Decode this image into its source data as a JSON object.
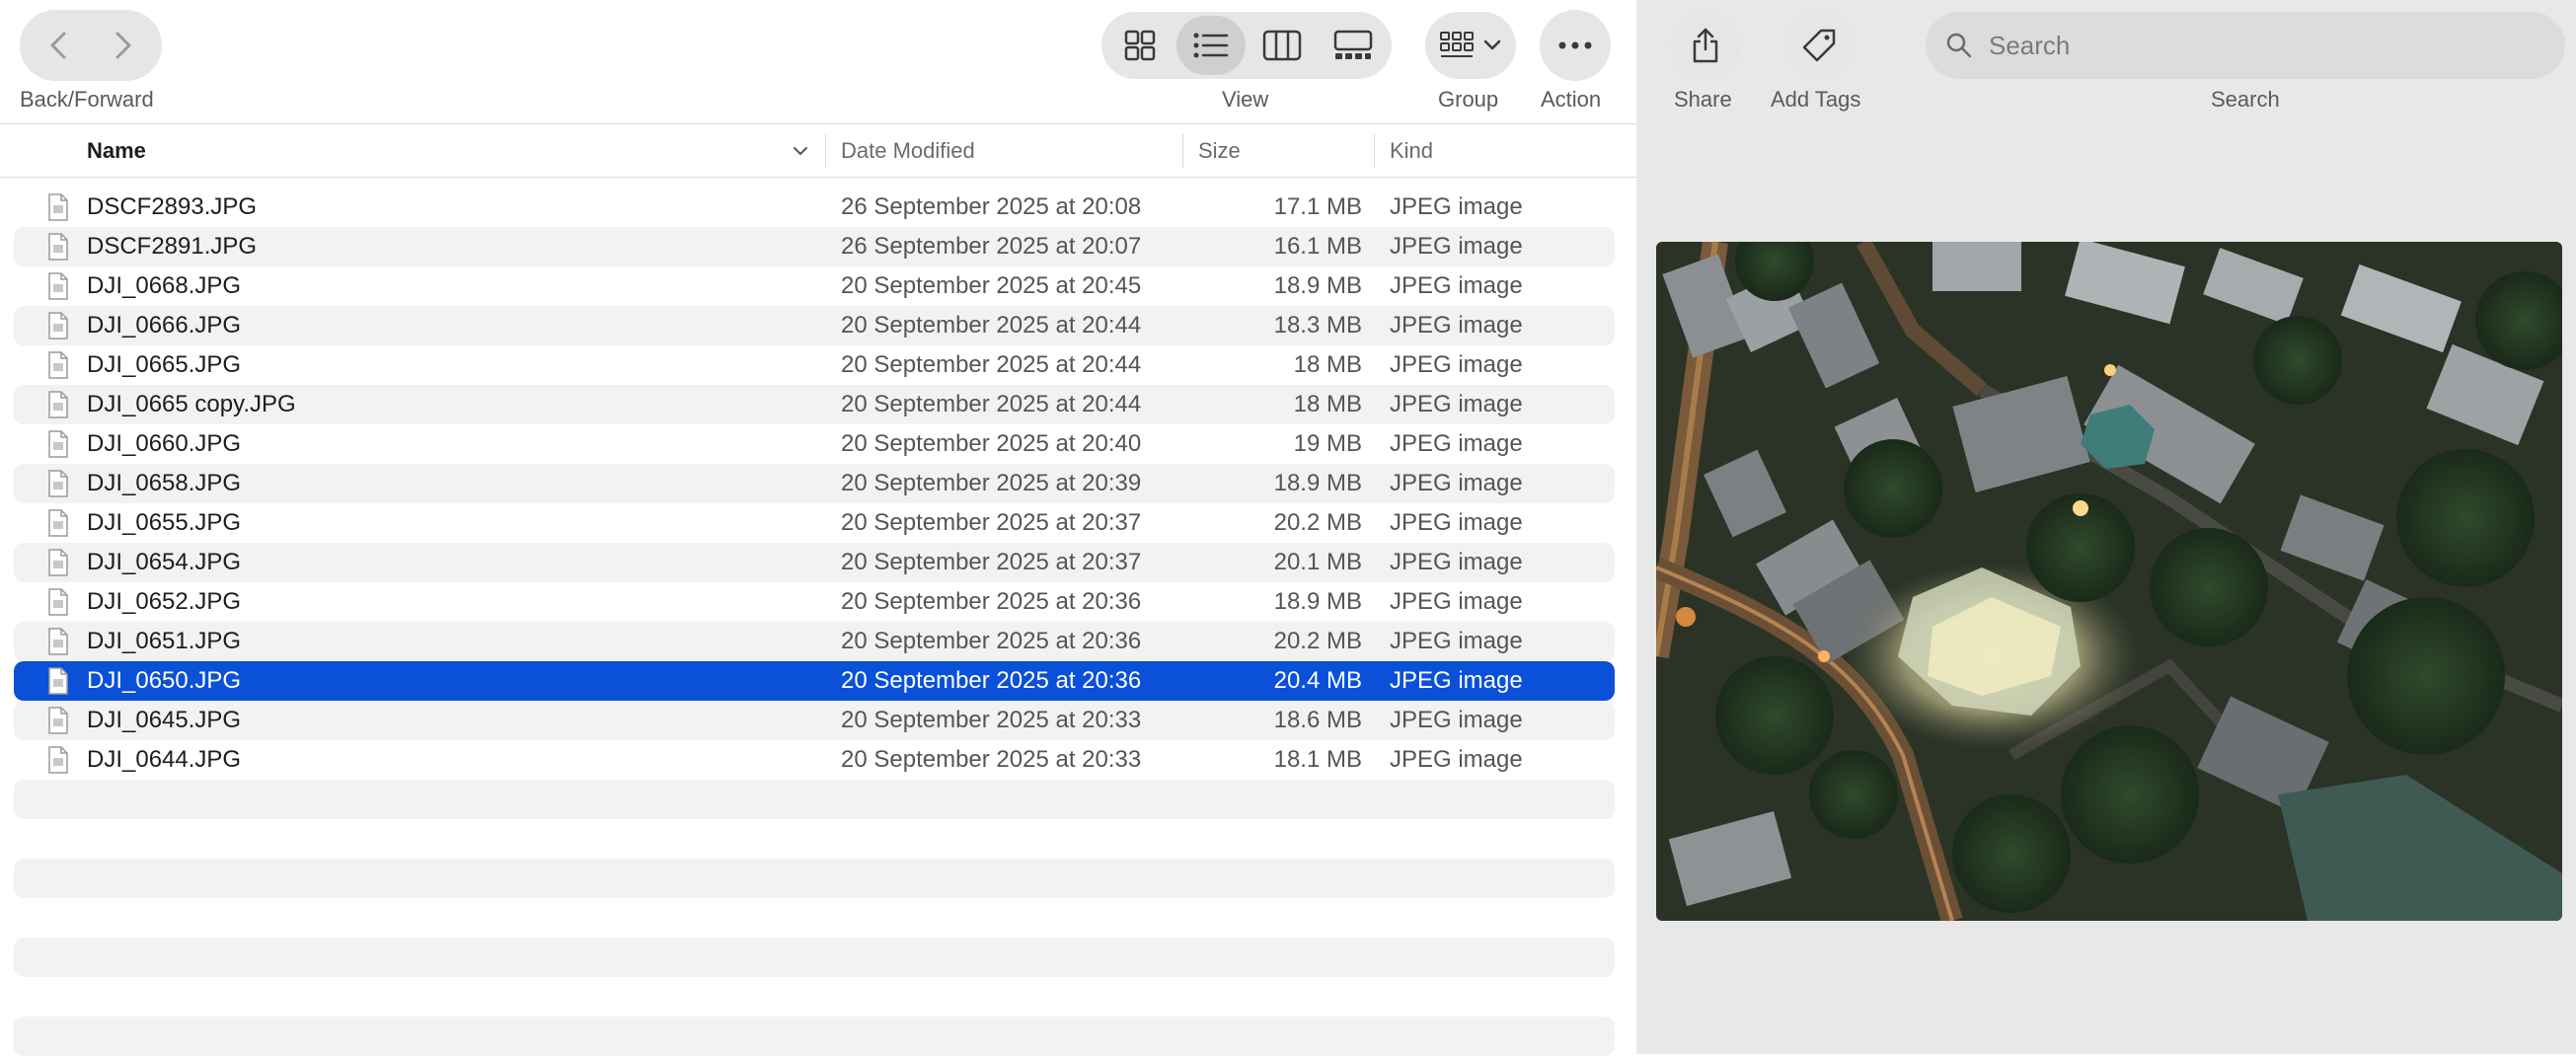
{
  "toolbar": {
    "nav_label": "Back/Forward",
    "view_label": "View",
    "group_label": "Group",
    "action_label": "Action",
    "share_label": "Share",
    "add_tags_label": "Add Tags",
    "search_label": "Search",
    "search_placeholder": "Search",
    "active_view": "list"
  },
  "columns": {
    "name": "Name",
    "date": "Date Modified",
    "size": "Size",
    "kind": "Kind"
  },
  "files": [
    {
      "name": "DSCF2893.JPG",
      "date": "26 September 2025 at 20:08",
      "size": "17.1 MB",
      "kind": "JPEG image"
    },
    {
      "name": "DSCF2891.JPG",
      "date": "26 September 2025 at 20:07",
      "size": "16.1 MB",
      "kind": "JPEG image"
    },
    {
      "name": "DJI_0668.JPG",
      "date": "20 September 2025 at 20:45",
      "size": "18.9 MB",
      "kind": "JPEG image"
    },
    {
      "name": "DJI_0666.JPG",
      "date": "20 September 2025 at 20:44",
      "size": "18.3 MB",
      "kind": "JPEG image"
    },
    {
      "name": "DJI_0665.JPG",
      "date": "20 September 2025 at 20:44",
      "size": "18 MB",
      "kind": "JPEG image"
    },
    {
      "name": "DJI_0665 copy.JPG",
      "date": "20 September 2025 at 20:44",
      "size": "18 MB",
      "kind": "JPEG image"
    },
    {
      "name": "DJI_0660.JPG",
      "date": "20 September 2025 at 20:40",
      "size": "19 MB",
      "kind": "JPEG image"
    },
    {
      "name": "DJI_0658.JPG",
      "date": "20 September 2025 at 20:39",
      "size": "18.9 MB",
      "kind": "JPEG image"
    },
    {
      "name": "DJI_0655.JPG",
      "date": "20 September 2025 at 20:37",
      "size": "20.2 MB",
      "kind": "JPEG image"
    },
    {
      "name": "DJI_0654.JPG",
      "date": "20 September 2025 at 20:37",
      "size": "20.1 MB",
      "kind": "JPEG image"
    },
    {
      "name": "DJI_0652.JPG",
      "date": "20 September 2025 at 20:36",
      "size": "18.9 MB",
      "kind": "JPEG image"
    },
    {
      "name": "DJI_0651.JPG",
      "date": "20 September 2025 at 20:36",
      "size": "20.2 MB",
      "kind": "JPEG image"
    },
    {
      "name": "DJI_0650.JPG",
      "date": "20 September 2025 at 20:36",
      "size": "20.4 MB",
      "kind": "JPEG image",
      "selected": true
    },
    {
      "name": "DJI_0645.JPG",
      "date": "20 September 2025 at 20:33",
      "size": "18.6 MB",
      "kind": "JPEG image"
    },
    {
      "name": "DJI_0644.JPG",
      "date": "20 September 2025 at 20:33",
      "size": "18.1 MB",
      "kind": "JPEG image"
    }
  ],
  "empty_rows": 7,
  "colors": {
    "selection": "#0a50d8",
    "stripe": "#f2f2f2",
    "preview_bg": "#e8e8e8"
  },
  "preview": {
    "subject": "aerial-night-city-photo"
  }
}
